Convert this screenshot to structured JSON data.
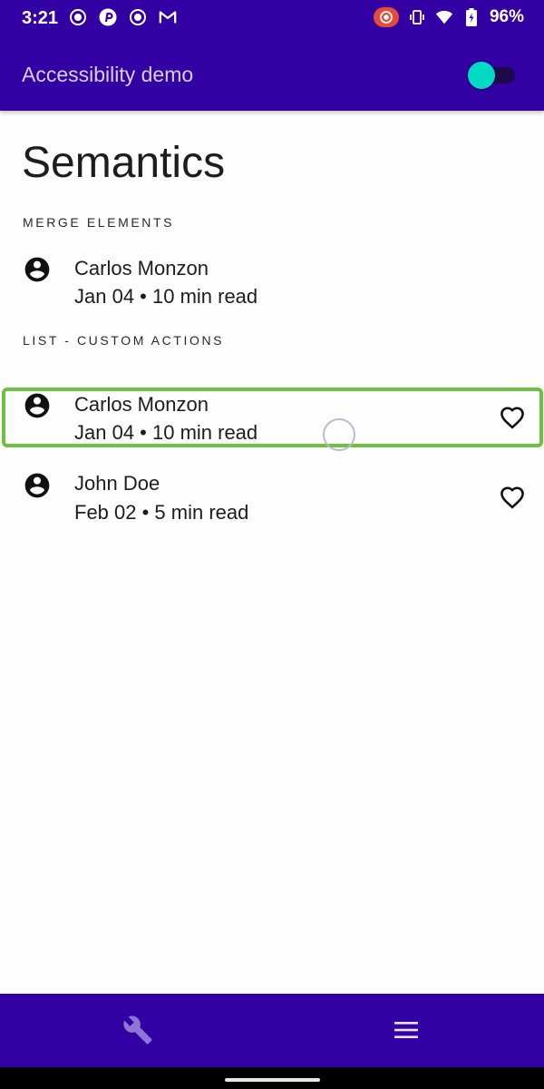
{
  "status_bar": {
    "time": "3:21",
    "battery_percent": "96%",
    "left_icons": [
      "record-icon",
      "pinterest-icon",
      "record-icon",
      "gmail-icon"
    ],
    "right_icons": [
      "screen-record-icon",
      "vibrate-icon",
      "wifi-icon",
      "battery-icon"
    ]
  },
  "app_bar": {
    "title": "Accessibility demo",
    "toggle_on": true,
    "toggle_color": "#03dac5"
  },
  "page": {
    "title": "Semantics",
    "sections": [
      {
        "label": "MERGE ELEMENTS",
        "items": [
          {
            "name": "Carlos Monzon",
            "meta": "Jan 04 • 10 min read"
          }
        ]
      },
      {
        "label": "LIST - CUSTOM ACTIONS",
        "items": [
          {
            "name": "Carlos Monzon",
            "meta": "Jan 04 • 10 min read",
            "focused": true
          },
          {
            "name": "John Doe",
            "meta": "Feb 02 • 5 min read"
          }
        ]
      }
    ]
  },
  "bottom_nav": {
    "items": [
      "wrench-icon",
      "menu-icon"
    ]
  },
  "colors": {
    "primary": "#3300a3",
    "focus_highlight": "#6cc13e",
    "background": "#fdfdfd"
  }
}
